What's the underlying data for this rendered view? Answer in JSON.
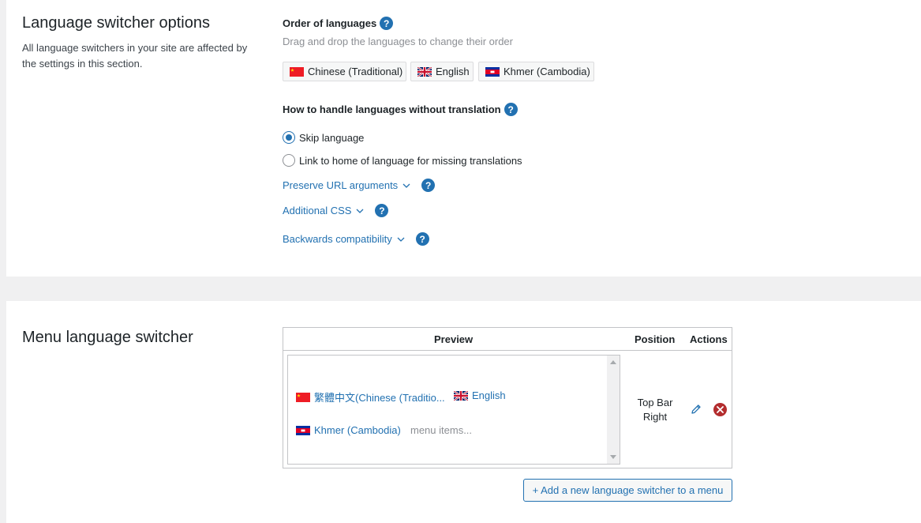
{
  "switcher_options": {
    "title": "Language switcher options",
    "description": "All language switchers in your site are affected by the settings in this section.",
    "order": {
      "heading": "Order of languages",
      "hint": "Drag and drop the languages to change their order",
      "languages": [
        {
          "label": "Chinese (Traditional)",
          "flag": "flag-china-icon"
        },
        {
          "label": "English",
          "flag": "flag-uk-icon"
        },
        {
          "label": "Khmer (Cambodia)",
          "flag": "flag-cambodia-icon"
        }
      ]
    },
    "untranslated": {
      "heading": "How to handle languages without translation",
      "options": [
        {
          "label": "Skip language",
          "checked": true
        },
        {
          "label": "Link to home of language for missing translations",
          "checked": false
        }
      ]
    },
    "toggles": [
      {
        "label": "Preserve URL arguments"
      },
      {
        "label": "Additional CSS"
      },
      {
        "label": "Backwards compatibility"
      }
    ],
    "help_symbol": "?"
  },
  "menu_switcher": {
    "title": "Menu language switcher",
    "table": {
      "columns": {
        "preview": "Preview",
        "position": "Position",
        "actions": "Actions"
      },
      "row": {
        "preview_items": [
          {
            "label": "繁體中文(Chinese (Traditio...",
            "flag": "flag-china-icon"
          },
          {
            "label": "English",
            "flag": "flag-uk-icon"
          },
          {
            "label": "Khmer (Cambodia)",
            "flag": "flag-cambodia-icon"
          },
          {
            "label": "menu items..."
          }
        ],
        "position_line1": "Top Bar",
        "position_line2": "Right"
      }
    },
    "add_button": "+ Add a new language switcher to a menu"
  },
  "colors": {
    "accent": "#2271b1",
    "danger": "#b32d2e",
    "background": "#f0f0f1",
    "panel": "#ffffff"
  }
}
